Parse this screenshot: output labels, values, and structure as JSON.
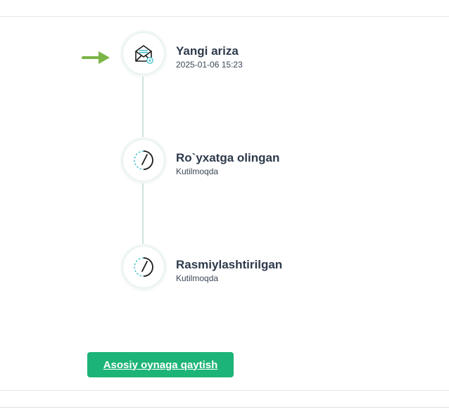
{
  "timeline": {
    "steps": [
      {
        "title": "Yangi ariza",
        "subtitle": "2025-01-06 15:23",
        "icon": "envelope-icon",
        "state": "completed"
      },
      {
        "title": "Ro`yxatga olingan",
        "subtitle": "Kutilmoqda",
        "icon": "clock-pending-icon",
        "state": "pending"
      },
      {
        "title": "Rasmiylashtirilgan",
        "subtitle": "Kutilmoqda",
        "icon": "clock-pending-icon",
        "state": "pending"
      }
    ]
  },
  "current_step_indicator": {
    "icon": "arrow-right-icon",
    "color": "#7ab547"
  },
  "actions": {
    "back_label": "Asosiy oynaga qaytish",
    "back_color": "#1db477"
  },
  "colors": {
    "title": "#2d3a4b",
    "timeline_line": "#cfe3dd",
    "icon_accent": "#4fc3d0"
  }
}
